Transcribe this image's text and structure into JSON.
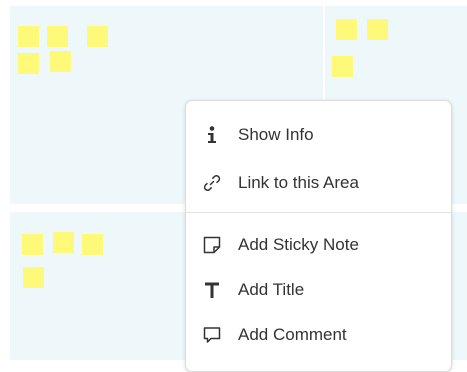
{
  "colors": {
    "area_background": "#eef8fa",
    "sticky_note": "#fff97a",
    "menu_background": "#ffffff",
    "menu_text": "#333333"
  },
  "context_menu": {
    "items": [
      {
        "label": "Show Info",
        "icon": "info-icon"
      },
      {
        "label": "Link to this Area",
        "icon": "link-icon"
      },
      {
        "label": "Add Sticky Note",
        "icon": "sticky-note-icon"
      },
      {
        "label": "Add Title",
        "icon": "title-text-icon"
      },
      {
        "label": "Add Comment",
        "icon": "comment-icon"
      }
    ]
  }
}
